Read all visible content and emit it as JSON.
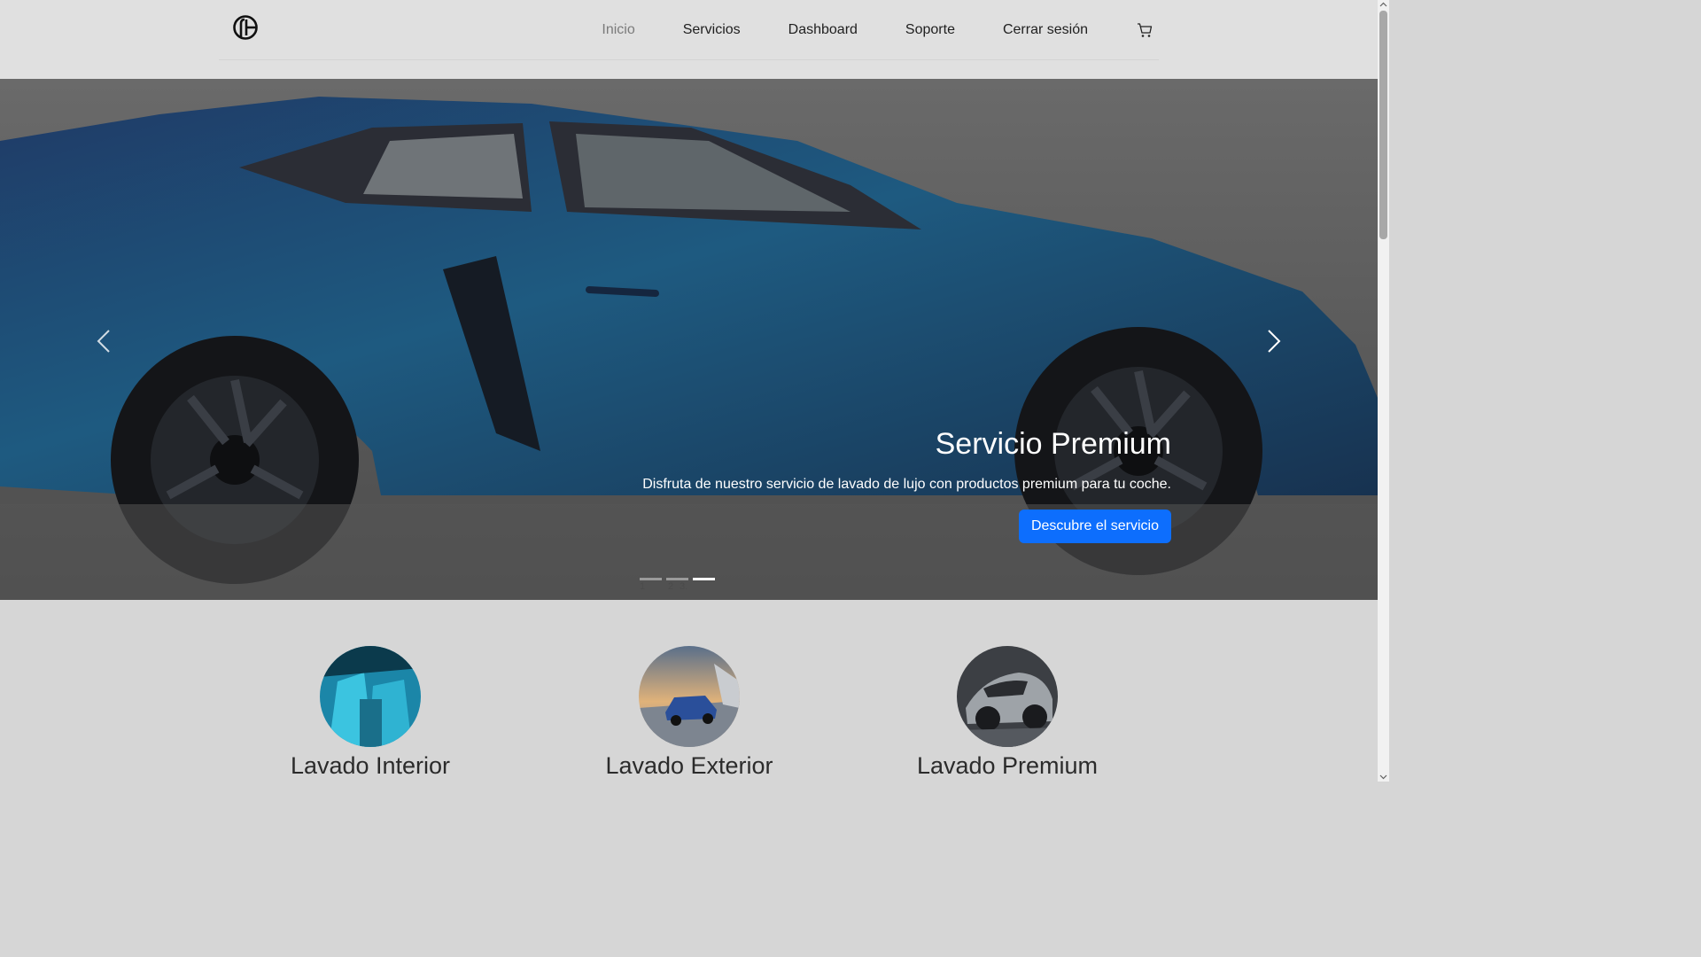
{
  "nav": {
    "items": [
      {
        "label": "Inicio",
        "active": true
      },
      {
        "label": "Servicios",
        "active": false
      },
      {
        "label": "Dashboard",
        "active": false
      },
      {
        "label": "Soporte",
        "active": false
      },
      {
        "label": "Cerrar sesión",
        "active": false
      }
    ],
    "cart_icon": "cart-icon"
  },
  "hero": {
    "title": "Servicio Premium",
    "text": "Disfruta de nuestro servicio de lavado de lujo con productos premium para tu coche.",
    "button": "Descubre el servicio",
    "indicators": [
      "1",
      "2",
      "3."
    ],
    "active_indicator": 3
  },
  "services": [
    {
      "title": "Lavado Interior"
    },
    {
      "title": "Lavado Exterior"
    },
    {
      "title": "Lavado Premium"
    }
  ],
  "colors": {
    "accent": "#0d6efd",
    "header_bg": "#e0e0e0",
    "page_bg": "#d6d6d6"
  }
}
